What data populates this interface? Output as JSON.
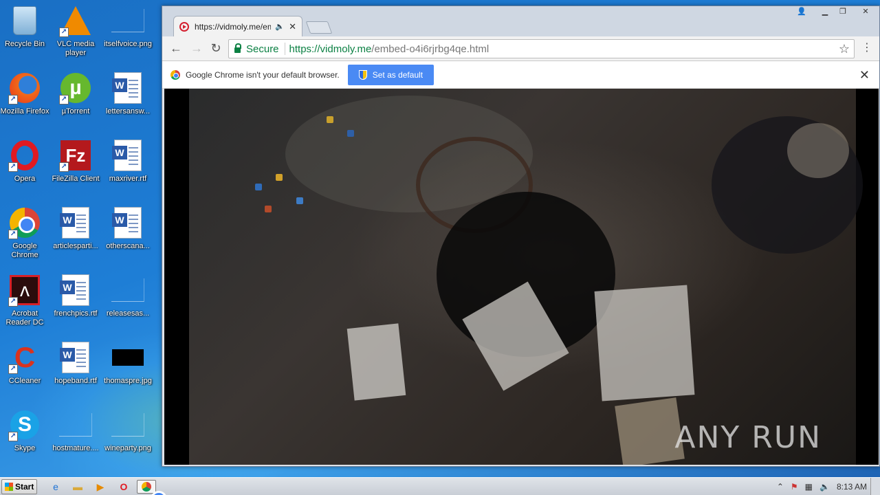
{
  "desktop": {
    "icons": [
      {
        "label": "Recycle Bin",
        "icon": "recycle-bin-icon"
      },
      {
        "label": "VLC media player",
        "icon": "vlc-icon"
      },
      {
        "label": "itselfvoice.png",
        "icon": "image-file-icon"
      },
      {
        "label": "Mozilla Firefox",
        "icon": "firefox-icon"
      },
      {
        "label": "µTorrent",
        "icon": "utorrent-icon"
      },
      {
        "label": "lettersansw...",
        "icon": "word-doc-icon"
      },
      {
        "label": "Opera",
        "icon": "opera-icon"
      },
      {
        "label": "FileZilla Client",
        "icon": "filezilla-icon"
      },
      {
        "label": "maxriver.rtf",
        "icon": "word-doc-icon"
      },
      {
        "label": "Google Chrome",
        "icon": "chrome-icon"
      },
      {
        "label": "articlesparti...",
        "icon": "word-doc-icon"
      },
      {
        "label": "otherscana...",
        "icon": "word-doc-icon"
      },
      {
        "label": "Acrobat Reader DC",
        "icon": "acrobat-icon"
      },
      {
        "label": "frenchpics.rtf",
        "icon": "word-doc-icon"
      },
      {
        "label": "releasesas...",
        "icon": "image-file-icon"
      },
      {
        "label": "CCleaner",
        "icon": "ccleaner-icon"
      },
      {
        "label": "hopeband.rtf",
        "icon": "word-doc-icon"
      },
      {
        "label": "thomaspre.jpg",
        "icon": "image-file-icon"
      },
      {
        "label": "Skype",
        "icon": "skype-icon"
      },
      {
        "label": "hostmature....",
        "icon": "image-file-icon"
      },
      {
        "label": "wineparty.png",
        "icon": "image-file-icon"
      }
    ]
  },
  "browser": {
    "tab": {
      "title": "https://vidmoly.me/emb",
      "audio_icon": "speaker-icon",
      "close": "✕"
    },
    "window_controls": {
      "minimize": "▁",
      "restore": "❐",
      "close": "✕"
    },
    "nav": {
      "back": "←",
      "forward": "→",
      "reload": "↻"
    },
    "omnibox": {
      "secure_label": "Secure",
      "url_scheme_host": "https://vidmoly.me",
      "url_path": "/embed-o4i6rjrbg4qe.html",
      "bookmark": "☆"
    },
    "menu": "⋮",
    "infobar": {
      "message": "Google Chrome isn't your default browser.",
      "button_label": "Set as default",
      "close": "✕"
    },
    "video": {
      "watermark": "ANY RUN"
    }
  },
  "taskbar": {
    "start_label": "Start",
    "pinned": [
      "internet-explorer-icon",
      "explorer-folder-icon",
      "media-player-icon",
      "opera-icon",
      "chrome-icon"
    ],
    "clock": "8:13 AM"
  }
}
